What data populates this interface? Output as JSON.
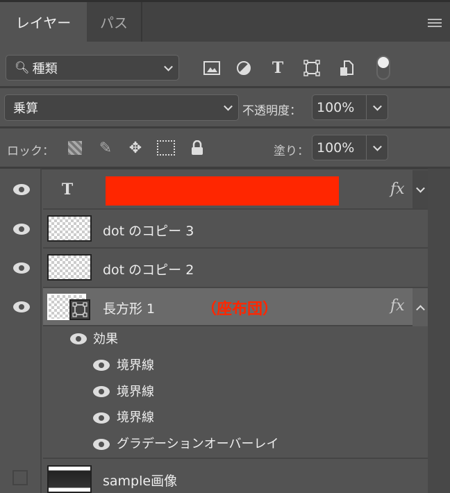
{
  "tabs": [
    {
      "label": "レイヤー",
      "active": true
    },
    {
      "label": "パス",
      "active": false
    }
  ],
  "filter": {
    "kind_label": "種類",
    "icons": [
      "image-filter-icon",
      "adjustment-filter-icon",
      "type-filter-icon",
      "shape-filter-icon",
      "smart-object-filter-icon"
    ]
  },
  "blend": {
    "mode": "乗算",
    "opacity_label": "不透明度：",
    "opacity": "100%"
  },
  "lock": {
    "label": "ロック：",
    "fill_label": "塗り：",
    "fill": "100%"
  },
  "layers": [
    {
      "name": "",
      "type": "text",
      "fx": "fx",
      "redacted_color": "#ff2600"
    },
    {
      "name": "dot のコピー 3"
    },
    {
      "name": "dot のコピー 2"
    },
    {
      "name": "長方形 1",
      "annotation": "（座布団）",
      "annotation_color": "#ff2600",
      "fx": "fx",
      "selected": true
    },
    {
      "name": "sample画像",
      "visible": false
    }
  ],
  "effects": {
    "label": "効果",
    "items": [
      "境界線",
      "境界線",
      "境界線",
      "グラデーションオーバーレイ"
    ]
  }
}
